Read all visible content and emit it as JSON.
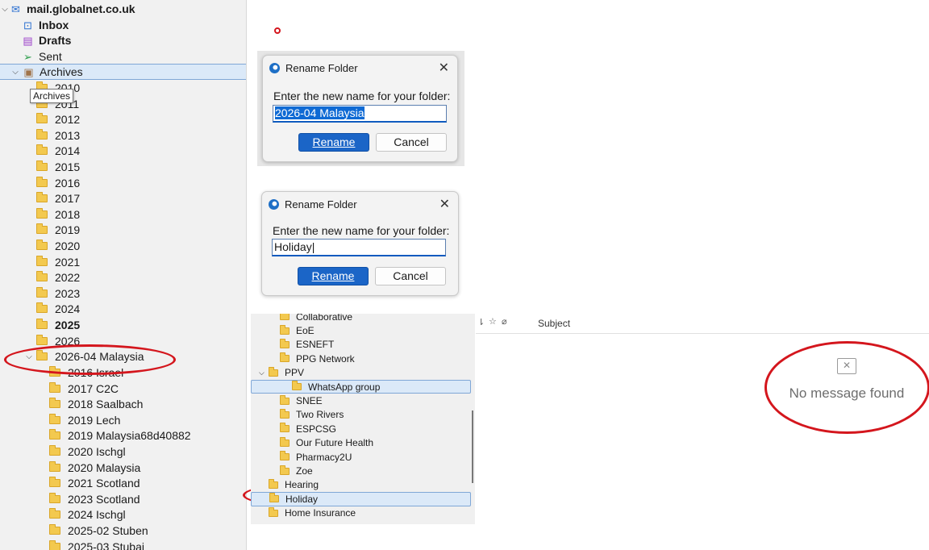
{
  "folder_pane": {
    "account": "mail.globalnet.co.uk",
    "special": [
      {
        "label": "Inbox",
        "icon": "inbox-icon"
      },
      {
        "label": "Drafts",
        "icon": "drafts-icon"
      },
      {
        "label": "Sent",
        "icon": "sent-icon"
      }
    ],
    "archives_label": "Archives",
    "tooltip": "Archives",
    "year_folders": [
      "2010",
      "2011",
      "2012",
      "2013",
      "2014",
      "2015",
      "2016",
      "2017",
      "2018",
      "2019",
      "2020",
      "2021",
      "2022",
      "2023",
      "2024",
      "2025",
      "2026"
    ],
    "selected_folder": "2026-04 Malaysia",
    "sub_folders": [
      "2016 Israel",
      "2017 C2C",
      "2018 Saalbach",
      "2019 Lech",
      "2019 Malaysia68d40882",
      "2020 Ischgl",
      "2020 Malaysia",
      "2021 Scotland",
      "2023 Scotland",
      "2024 Ischgl",
      "2025-02 Stuben",
      "2025-03 Stubai"
    ]
  },
  "dialog1": {
    "title": "Rename Folder",
    "prompt": "Enter the new name for your folder:",
    "value": "2026-04 Malaysia",
    "rename_label": "Rename",
    "cancel_label": "Cancel"
  },
  "dialog2": {
    "title": "Rename Folder",
    "prompt": "Enter the new name for your folder:",
    "value": "Holiday",
    "rename_label": "Rename",
    "cancel_label": "Cancel"
  },
  "folder_crop": {
    "items": [
      "Collaborative",
      "EoE",
      "ESNEFT",
      "PPG Network",
      "PPV",
      "WhatsApp group",
      "SNEE",
      "Two Rivers",
      "ESPCSG",
      "Our Future Health",
      "Pharmacy2U",
      "Zoe",
      "Hearing",
      "Holiday",
      "Home Insurance"
    ]
  },
  "message_list": {
    "subject_header": "Subject",
    "empty_text": "No message found"
  },
  "colors": {
    "annotation": "#d4161d",
    "selection": "#dbe9f8",
    "accent": "#1b65c7"
  }
}
